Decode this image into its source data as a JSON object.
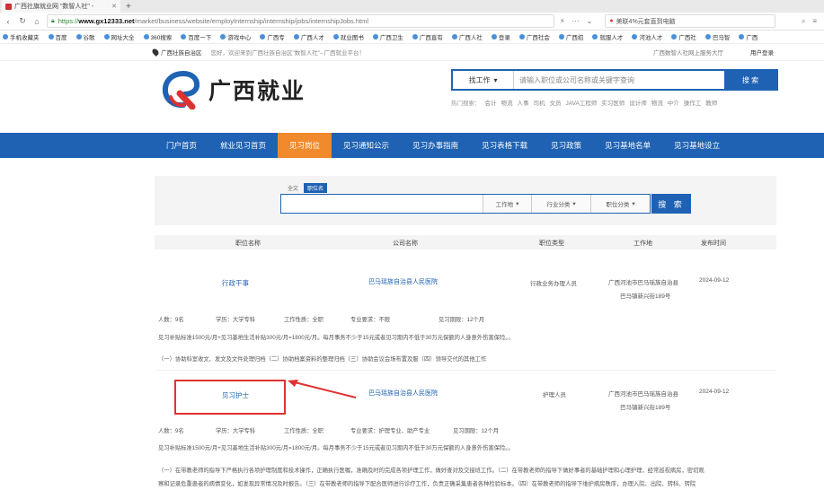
{
  "browser": {
    "tab_title": "广西社旗就业网 \"数智人社\" -",
    "url_prefix": "https://",
    "url_domain": "www.gx12333.net",
    "url_path": "/market/business/website/employInternship/internship/jobs/internshipJobs.html",
    "side_search": "美联4%元套直到电脑"
  },
  "bookmarks": [
    "手机收藏夹",
    "百度",
    "谷歌",
    "网址大全",
    "360搜索",
    "百度一下",
    "游戏中心",
    "广西专",
    "广西人才",
    "就业图书",
    "广西卫生",
    "广西直有",
    "广西人社",
    "登录",
    "广西社会",
    "广西招",
    "就服人才",
    "河池人才",
    "广西社",
    "巴马智",
    "广西"
  ],
  "site_top": {
    "location": "广西壮族自治区",
    "welcome": "您好，欢迎来到广西壮族自治区\"数智人社\"--广西就业平台！",
    "right1": "广西数智人社网上服务大厅",
    "right2": "用户登录"
  },
  "header": {
    "logo_text": "广西就业",
    "search_type": "找工作",
    "search_placeholder": "请输入职位或公司名称或关键字查询",
    "search_button": "搜 索",
    "hot_label": "热门搜索：",
    "hot_items": [
      "会计",
      "物流",
      "人事",
      "司机",
      "文员",
      "JAVA工程师",
      "实习医师",
      "设计师",
      "物流",
      "中介",
      "操作工",
      "教师"
    ]
  },
  "nav": [
    "门户首页",
    "就业见习首页",
    "见习岗位",
    "见习通知公示",
    "见习办事指南",
    "见习表格下载",
    "见习政策",
    "见习基地名单",
    "见习基地设立"
  ],
  "nav_active_index": 2,
  "filter": {
    "tabs": [
      "全文",
      "职位名"
    ],
    "active_tab": 1,
    "selects": [
      "工作地",
      "行业分类",
      "职位分类"
    ],
    "button": "搜 索"
  },
  "table": {
    "headers": [
      "职位名称",
      "公司名称",
      "职位类型",
      "工作地",
      "发布时间"
    ],
    "rows": [
      {
        "title": "行政干事",
        "company": "巴马瑶族自治县人民医院",
        "type": "行政业务办理人员",
        "location_l1": "广西河池市巴马瑶族自治县",
        "location_l2": "巴马镇新兴街189号",
        "date": "2024-09-12",
        "meta": [
          "人数：9名",
          "学历：大学专科",
          "工作性质：全职",
          "专业要求：不限",
          "见习期限：12个月"
        ],
        "salary": "见习补贴标准1500元/月+见习基地生活补贴300元/月=1800元/月。每月事务不少于15元或者见习期内不低于30万元保额的人身意外伤害保险。。",
        "desc": "（一）协助科室收文、发文及文件处理归档（二）协助档案资料的整理归档（三）协助会议会场布置及服（四）领导交代的其他工作"
      },
      {
        "title": "见习护士",
        "company": "巴马瑶族自治县人民医院",
        "type": "护理人员",
        "location_l1": "广西河池市巴马瑶族自治县",
        "location_l2": "巴马镇新兴街189号",
        "date": "2024-09-12",
        "meta": [
          "人数：9名",
          "学历：大学专科",
          "工作性质：全职",
          "专业要求：护理专业、助产专业",
          "见习期限：12个月"
        ],
        "salary": "见习补贴标准1500元/月+见习基地生活补贴300元/月=1800元/月。每月事务不少于15元或者见习期内不低于30万元保额的人身意外伤害保险。。",
        "desc1": "（一）在带教老师的指导下严格执行各项护理制度和技术操作，正确执行医嘱，准确及时的完成各项护理工作，做好查对及交接班工作。（二）在带教老师的指导下做好事者的基础护理和心理护理，经常巡视病房，密切观",
        "desc2": "察和记录危重患者的病情变化，如发现异常情况及时报告。（三）在带教老师的指导下配合医师进行诊疗工作，负责正确采集患者各种检验标本。（四）在带教老师的指导下维护病房秩序，办理入院、出院、转科、转院"
      }
    ]
  }
}
